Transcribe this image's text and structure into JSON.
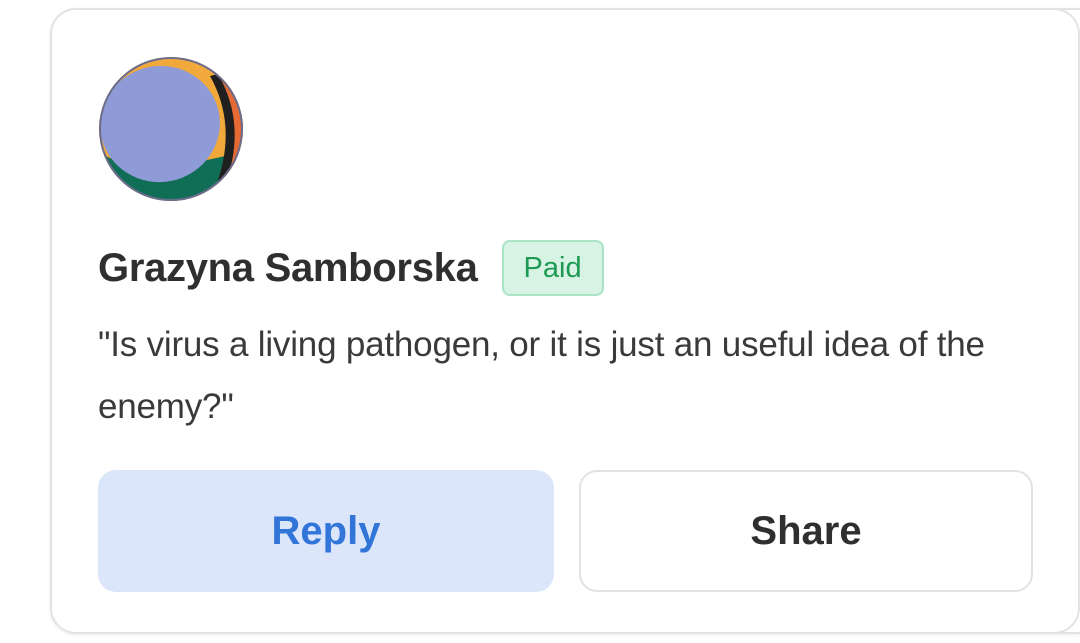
{
  "comment": {
    "author_name": "Grazyna Samborska",
    "badge_label": "Paid",
    "message": "\"Is virus a living pathogen, or it is just an useful idea of the enemy?\"",
    "avatar_icon": "abstract-circle-avatar"
  },
  "actions": {
    "reply_label": "Reply",
    "share_label": "Share"
  },
  "colors": {
    "badge_bg": "#d7f3e4",
    "badge_text": "#1e9a55",
    "reply_bg": "#dce6fb",
    "reply_text": "#3175d9",
    "text_primary": "#2f2f2f"
  }
}
